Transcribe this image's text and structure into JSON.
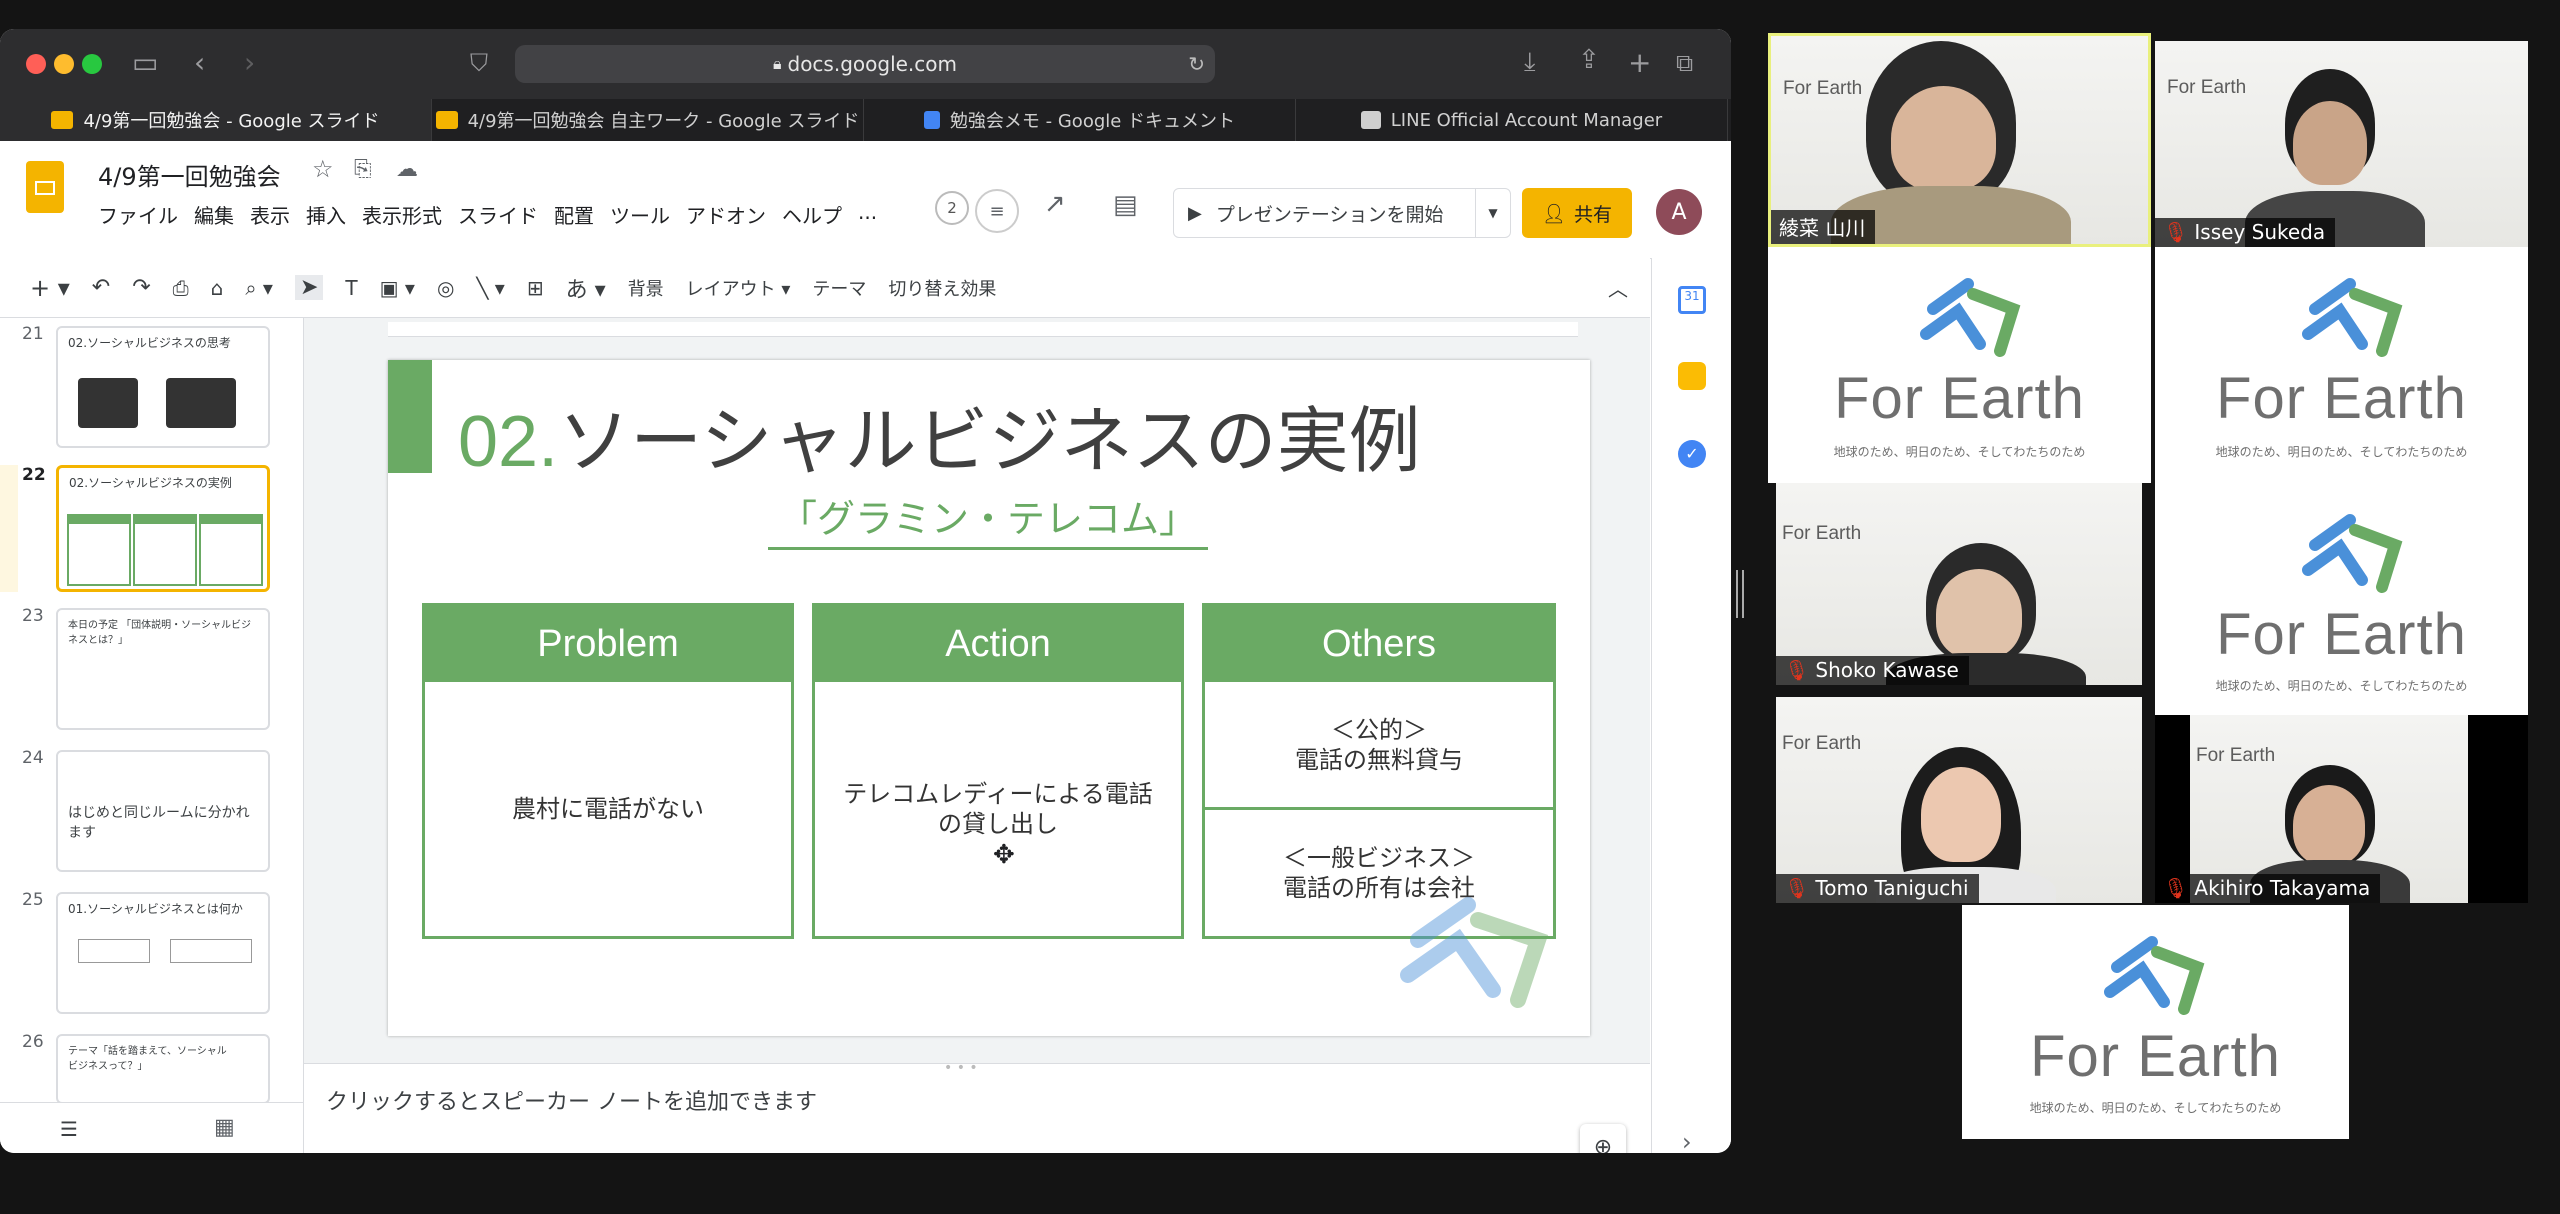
{
  "browser": {
    "url": "docs.google.com",
    "tabs": [
      {
        "label": "4/9第一回勉強会 - Google スライド",
        "active": true,
        "favicon_color": "#f4b400"
      },
      {
        "label": "4/9第一回勉強会 自主ワーク - Google スライド",
        "active": false,
        "favicon_color": "#f4b400"
      },
      {
        "label": "勉強会メモ - Google ドキュメント",
        "active": false,
        "favicon_color": "#4285f4"
      },
      {
        "label": "LINE Official Account Manager",
        "active": false,
        "favicon_color": "#cfcfcf"
      }
    ]
  },
  "doc": {
    "title": "4/9第一回勉強会",
    "menu": [
      "ファイル",
      "編集",
      "表示",
      "挿入",
      "表示形式",
      "スライド",
      "配置",
      "ツール",
      "アドオン",
      "ヘルプ",
      "..."
    ],
    "viewer_count": "2",
    "present_label": "プレゼンテーションを開始",
    "share_label": "共有",
    "avatar_letter": "A"
  },
  "toolbar": {
    "items": [
      "背景",
      "レイアウト",
      "テーマ",
      "切り替え効果"
    ],
    "font_label": "あ"
  },
  "filmstrip": [
    {
      "num": "21",
      "title": "02.ソーシャルビジネスの思考",
      "selected": false
    },
    {
      "num": "22",
      "title": "02.ソーシャルビジネスの実例",
      "selected": true
    },
    {
      "num": "23",
      "title": "本日の予定 「団体説明・ソーシャルビジネスとは？」",
      "selected": false
    },
    {
      "num": "24",
      "title": "はじめと同じルームに分かれます",
      "selected": false
    },
    {
      "num": "25",
      "title": "01.ソーシャルビジネスとは何か",
      "selected": false
    },
    {
      "num": "26",
      "title": "テーマ「話を踏まえて、ソーシャルビジネスって？」",
      "selected": false
    }
  ],
  "slide": {
    "number": "02.",
    "title": "ソーシャルビジネスの実例",
    "subtitle": "「グラミン・テレコム」",
    "columns": {
      "problem": {
        "header": "Problem",
        "body": "農村に電話がない"
      },
      "action": {
        "header": "Action",
        "body": "テレコムレディーによる電話の貸し出し"
      },
      "others": {
        "header": "Others",
        "cell1_line1": "＜公的＞",
        "cell1_line2": "電話の無料貸与",
        "cell2_line1": "＜一般ビジネス＞",
        "cell2_line2": "電話の所有は会社"
      }
    },
    "accent_color": "#6aaa64"
  },
  "notes": {
    "placeholder": "クリックするとスピーカー ノートを追加できます"
  },
  "gallery": {
    "logo_text": "For Earth",
    "logo_tagline": "地球のため、明日のため、そしてわたちのため",
    "participants": [
      {
        "name": "綾菜 山川",
        "muted": false,
        "speaking": true
      },
      {
        "name": "Issey Sukeda",
        "muted": true
      },
      {
        "name": "Shoko Kawase",
        "muted": true
      },
      {
        "name": "Tomo Taniguchi",
        "muted": true
      },
      {
        "name": "Akihiro Takayama",
        "muted": true
      }
    ]
  }
}
